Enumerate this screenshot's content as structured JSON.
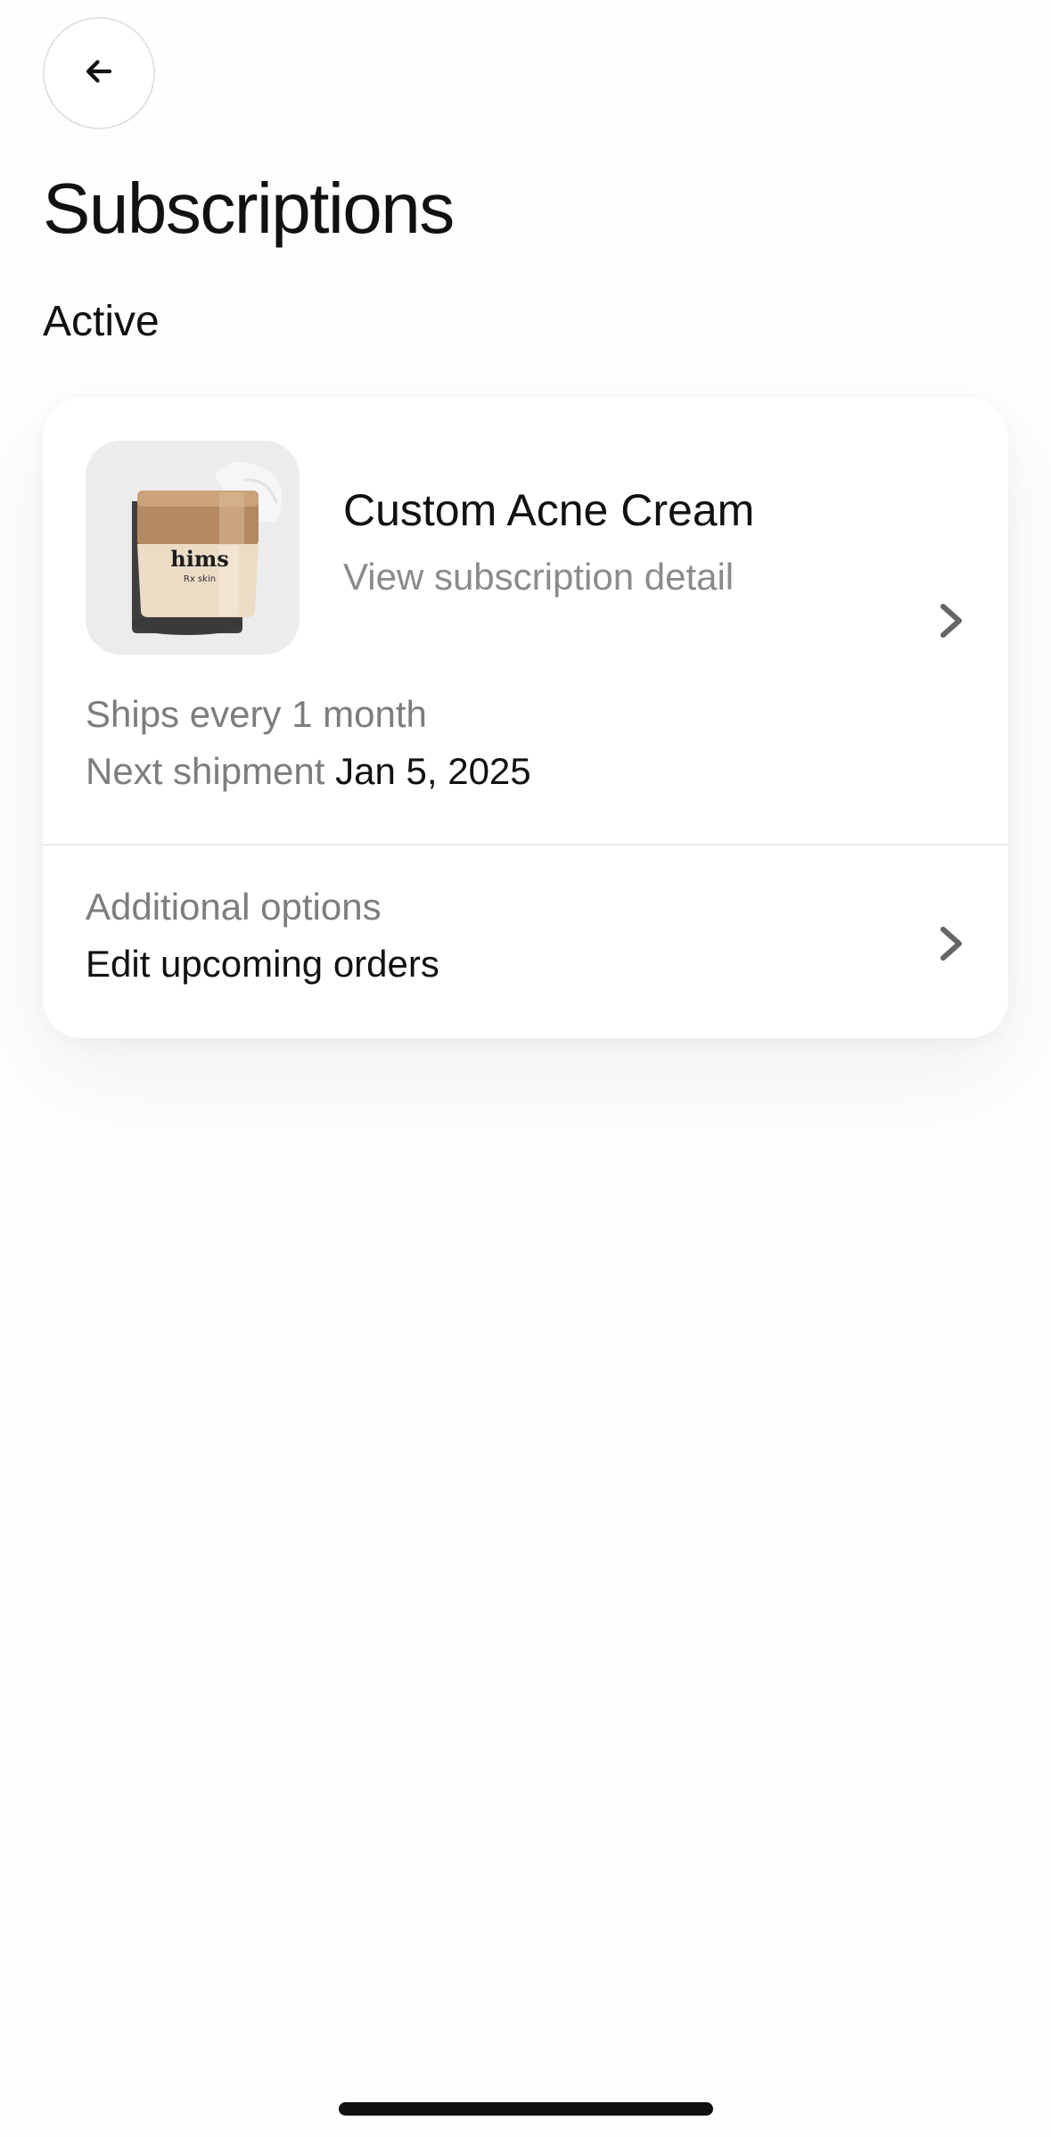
{
  "header": {
    "back_icon": "arrow-left-icon",
    "title": "Subscriptions"
  },
  "section": {
    "label": "Active"
  },
  "subscription": {
    "product_image": "acne-cream-jar",
    "product_image_text": {
      "brand": "hims",
      "line": "Rx skin"
    },
    "name": "Custom Acne Cream",
    "detail_link": "View subscription detail",
    "frequency": "Ships every 1 month",
    "next_shipment_label": "Next shipment",
    "next_shipment_date": "Jan 5, 2025",
    "chevron_icon": "chevron-right-icon"
  },
  "options": {
    "title": "Additional options",
    "action": "Edit upcoming orders",
    "chevron_icon": "chevron-right-icon"
  },
  "colors": {
    "background": "#fefefe",
    "card": "#ffffff",
    "text_primary": "#111111",
    "text_secondary": "#7d7d7d",
    "image_tile": "#ececec"
  }
}
